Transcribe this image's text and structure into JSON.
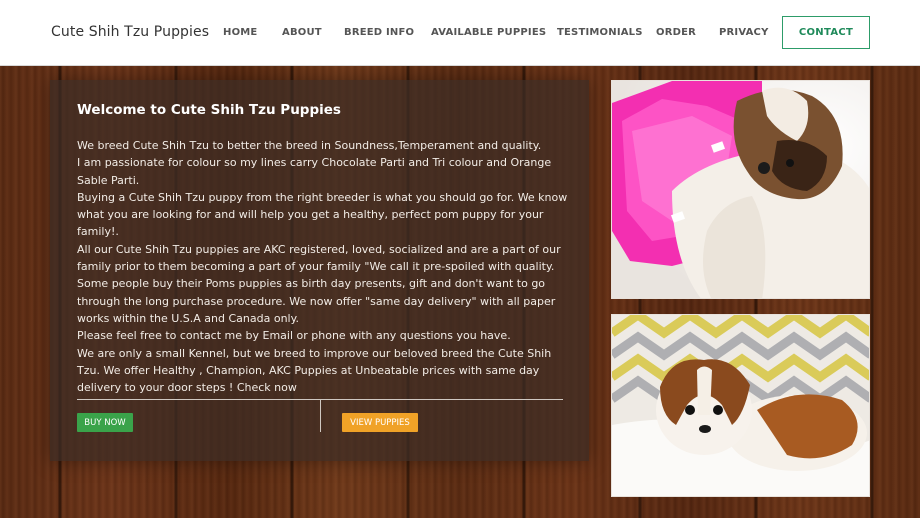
{
  "header": {
    "brand": "Cute Shih Tzu Puppies",
    "nav": [
      "HOME",
      "ABOUT",
      "BREED INFO",
      "AVAILABLE PUPPIES",
      "TESTIMONIALS",
      "ORDER",
      "PRIVACY"
    ],
    "contact_label": "CONTACT"
  },
  "main": {
    "title": "Welcome to Cute Shih Tzu Puppies",
    "paragraphs": [
      "We breed Cute Shih Tzu to better the breed in Soundness,Temperament and quality.",
      "I am passionate for colour so my lines carry Chocolate Parti and Tri colour and Orange Sable Parti.",
      "Buying a Cute Shih Tzu puppy from the right breeder is what you should go for. We know what you are looking for and will help you get a healthy, perfect pom puppy for your family!.",
      "All our Cute Shih Tzu puppies are AKC registered, loved, socialized and are a part of our family prior to them becoming a part of your family \"We call it pre-spoiled with quality.",
      "Some people buy their Poms puppies as birth day presents, gift and don't want to go through the long purchase procedure. We now offer \"same day delivery\" with all paper works within the U.S.A and Canada only.",
      "Please feel free to contact me by Email or phone with any questions you have.",
      "We are only a small Kennel, but we breed to improve our beloved breed the Cute Shih Tzu. We offer Healthy , Champion, AKC Puppies at Unbeatable prices with same day delivery to your door steps ! Check now"
    ],
    "buy_label": "BUY NOW",
    "view_label": "VIEW PUPPIES"
  },
  "colors": {
    "accent_green": "#3aa34a",
    "accent_orange": "#f0a227",
    "contact_green": "#2d9c69",
    "panel_bg": "rgba(60,45,38,0.72)"
  }
}
